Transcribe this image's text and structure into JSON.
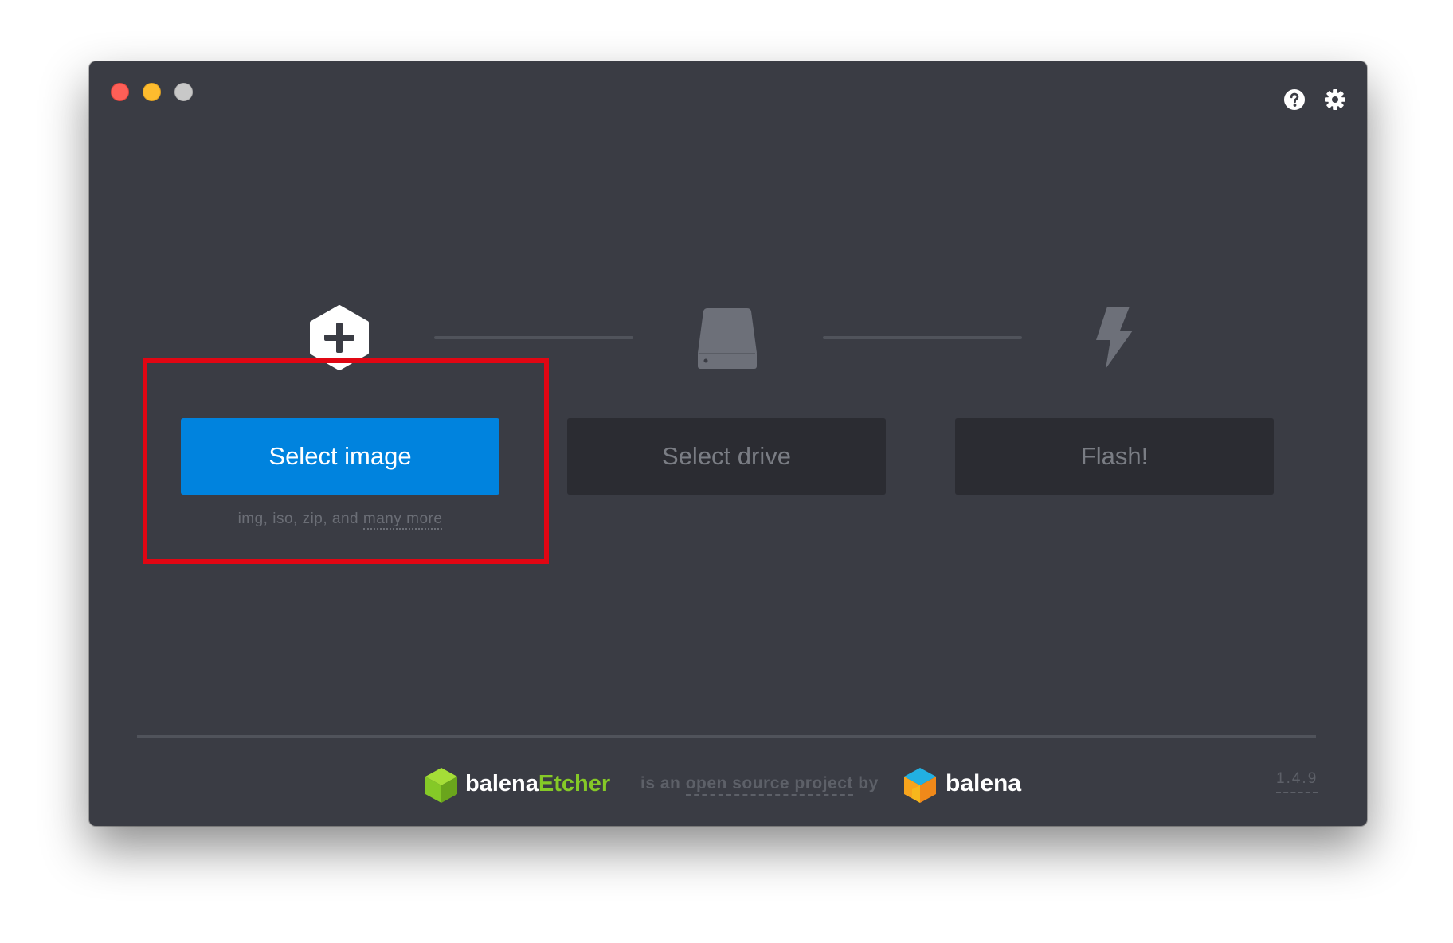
{
  "window": {
    "controls": [
      "close",
      "minimize",
      "maximize"
    ],
    "top_icons": [
      "help-icon",
      "gear-icon"
    ]
  },
  "steps": {
    "image": {
      "icon": "plus-hexagon-icon",
      "button_label": "Select image"
    },
    "drive": {
      "icon": "drive-icon",
      "button_label": "Select drive"
    },
    "flash": {
      "icon": "lightning-icon",
      "button_label": "Flash!"
    }
  },
  "image_subtext": {
    "prefix": "img, iso, zip, and ",
    "link": "many more"
  },
  "footer": {
    "brand_primary": "balena",
    "brand_accent": "Etcher",
    "open_source_prefix": "is an ",
    "open_source_link": "open source project",
    "open_source_suffix": " by",
    "company": "balena",
    "version": "1.4.9"
  },
  "colors": {
    "window_bg": "#3a3c44",
    "primary_button": "#0083de",
    "disabled_button": "#2b2c32",
    "highlight": "#e10613",
    "etcher_accent": "#85c927"
  }
}
